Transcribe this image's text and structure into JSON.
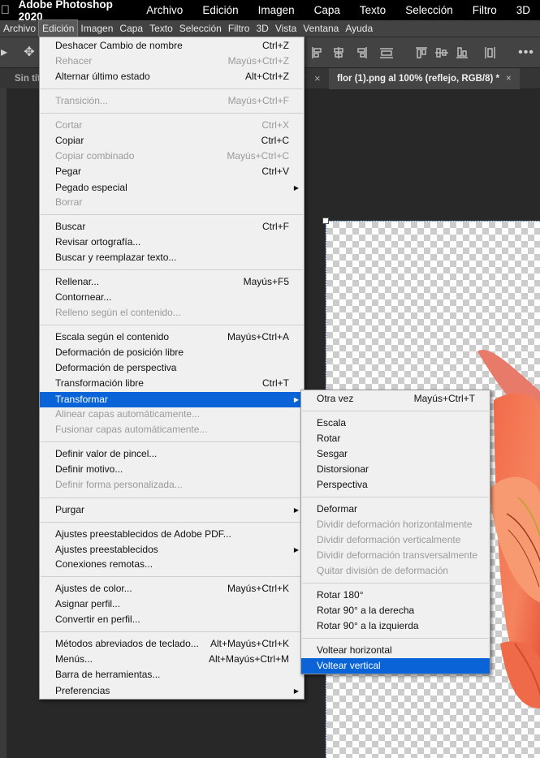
{
  "os_menubar": {
    "app_name": "Adobe Photoshop 2020",
    "items": [
      "Archivo",
      "Edición",
      "Imagen",
      "Capa",
      "Texto",
      "Selección",
      "Filtro",
      "3D"
    ]
  },
  "app_menubar": {
    "items": [
      "Archivo",
      "Edición",
      "Imagen",
      "Capa",
      "Texto",
      "Selección",
      "Filtro",
      "3D",
      "Vista",
      "Ventana",
      "Ayuda"
    ]
  },
  "tabs": {
    "inactive_label": "Sin títu",
    "inactive_suffix": "*",
    "active_label": "flor (1).png al 100% (reflejo, RGB/8) *",
    "close_glyph": "×"
  },
  "edit_menu": {
    "items": [
      {
        "label": "Deshacer Cambio de nombre",
        "shortcut": "Ctrl+Z",
        "disabled": false
      },
      {
        "label": "Rehacer",
        "shortcut": "Mayús+Ctrl+Z",
        "disabled": true
      },
      {
        "label": "Alternar último estado",
        "shortcut": "Alt+Ctrl+Z",
        "disabled": false
      },
      {
        "label": "Transición...",
        "shortcut": "Mayús+Ctrl+F",
        "disabled": true
      },
      {
        "label": "Cortar",
        "shortcut": "Ctrl+X",
        "disabled": true
      },
      {
        "label": "Copiar",
        "shortcut": "Ctrl+C",
        "disabled": false
      },
      {
        "label": "Copiar combinado",
        "shortcut": "Mayús+Ctrl+C",
        "disabled": true
      },
      {
        "label": "Pegar",
        "shortcut": "Ctrl+V",
        "disabled": false
      },
      {
        "label": "Pegado especial",
        "shortcut": "",
        "disabled": false,
        "submenu": true
      },
      {
        "label": "Borrar",
        "shortcut": "",
        "disabled": true
      },
      {
        "label": "Buscar",
        "shortcut": "Ctrl+F",
        "disabled": false
      },
      {
        "label": "Revisar ortografía...",
        "shortcut": "",
        "disabled": false
      },
      {
        "label": "Buscar y reemplazar texto...",
        "shortcut": "",
        "disabled": false
      },
      {
        "label": "Rellenar...",
        "shortcut": "Mayús+F5",
        "disabled": false
      },
      {
        "label": "Contornear...",
        "shortcut": "",
        "disabled": false
      },
      {
        "label": "Relleno según el contenido...",
        "shortcut": "",
        "disabled": true
      },
      {
        "label": "Escala según el contenido",
        "shortcut": "Mayús+Ctrl+A",
        "disabled": false
      },
      {
        "label": "Deformación de posición libre",
        "shortcut": "",
        "disabled": false
      },
      {
        "label": "Deformación de perspectiva",
        "shortcut": "",
        "disabled": false
      },
      {
        "label": "Transformación libre",
        "shortcut": "Ctrl+T",
        "disabled": false
      },
      {
        "label": "Transformar",
        "shortcut": "",
        "disabled": false,
        "submenu": true,
        "highlighted": true
      },
      {
        "label": "Alinear capas automáticamente...",
        "shortcut": "",
        "disabled": true
      },
      {
        "label": "Fusionar capas automáticamente...",
        "shortcut": "",
        "disabled": true
      },
      {
        "label": "Definir valor de pincel...",
        "shortcut": "",
        "disabled": false
      },
      {
        "label": "Definir motivo...",
        "shortcut": "",
        "disabled": false
      },
      {
        "label": "Definir forma personalizada...",
        "shortcut": "",
        "disabled": true
      },
      {
        "label": "Purgar",
        "shortcut": "",
        "disabled": false,
        "submenu": true
      },
      {
        "label": "Ajustes preestablecidos de Adobe PDF...",
        "shortcut": "",
        "disabled": false
      },
      {
        "label": "Ajustes preestablecidos",
        "shortcut": "",
        "disabled": false,
        "submenu": true
      },
      {
        "label": "Conexiones remotas...",
        "shortcut": "",
        "disabled": false
      },
      {
        "label": "Ajustes de color...",
        "shortcut": "Mayús+Ctrl+K",
        "disabled": false
      },
      {
        "label": "Asignar perfil...",
        "shortcut": "",
        "disabled": false
      },
      {
        "label": "Convertir en perfil...",
        "shortcut": "",
        "disabled": false
      },
      {
        "label": "Métodos abreviados de teclado...",
        "shortcut": "Alt+Mayús+Ctrl+K",
        "disabled": false
      },
      {
        "label": "Menús...",
        "shortcut": "Alt+Mayús+Ctrl+M",
        "disabled": false
      },
      {
        "label": "Barra de herramientas...",
        "shortcut": "",
        "disabled": false
      },
      {
        "label": "Preferencias",
        "shortcut": "",
        "disabled": false,
        "submenu": true
      }
    ]
  },
  "transform_menu": {
    "items": [
      {
        "label": "Otra vez",
        "shortcut": "Mayús+Ctrl+T",
        "disabled": false
      },
      {
        "label": "Escala",
        "shortcut": "",
        "disabled": false
      },
      {
        "label": "Rotar",
        "shortcut": "",
        "disabled": false
      },
      {
        "label": "Sesgar",
        "shortcut": "",
        "disabled": false
      },
      {
        "label": "Distorsionar",
        "shortcut": "",
        "disabled": false
      },
      {
        "label": "Perspectiva",
        "shortcut": "",
        "disabled": false
      },
      {
        "label": "Deformar",
        "shortcut": "",
        "disabled": false
      },
      {
        "label": "Dividir deformación horizontalmente",
        "shortcut": "",
        "disabled": true
      },
      {
        "label": "Dividir deformación verticalmente",
        "shortcut": "",
        "disabled": true
      },
      {
        "label": "Dividir deformación transversalmente",
        "shortcut": "",
        "disabled": true
      },
      {
        "label": "Quitar división de deformación",
        "shortcut": "",
        "disabled": true
      },
      {
        "label": "Rotar 180°",
        "shortcut": "",
        "disabled": false
      },
      {
        "label": "Rotar 90° a la derecha",
        "shortcut": "",
        "disabled": false
      },
      {
        "label": "Rotar 90° a la izquierda",
        "shortcut": "",
        "disabled": false
      },
      {
        "label": "Voltear horizontal",
        "shortcut": "",
        "disabled": false
      },
      {
        "label": "Voltear vertical",
        "shortcut": "",
        "disabled": false,
        "highlighted": true
      }
    ]
  },
  "colors": {
    "highlight": "#0a64d8",
    "menu_bg": "#f0f0f0",
    "app_chrome": "#434343",
    "workspace": "#282828"
  }
}
